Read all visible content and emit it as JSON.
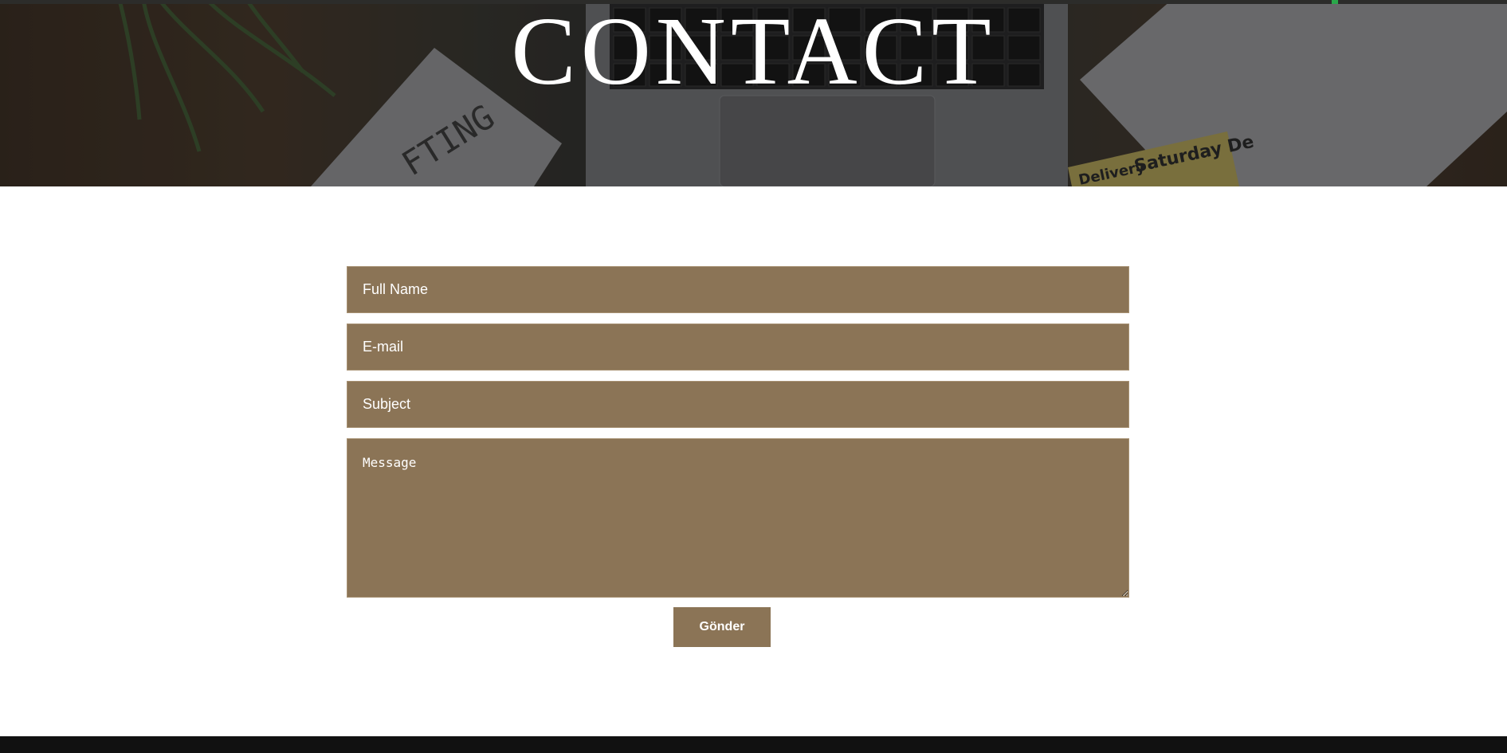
{
  "hero": {
    "title": "CONTACT",
    "image_text": {
      "card": "FTING",
      "label1": "Delivery",
      "label2": "Saturday De"
    }
  },
  "form": {
    "full_name_placeholder": "Full Name",
    "email_placeholder": "E-mail",
    "subject_placeholder": "Subject",
    "message_placeholder": "Message",
    "submit_label": "Gönder"
  },
  "colors": {
    "field_background": "#8b7456",
    "button_background": "#8b7456",
    "footer": "#111111"
  }
}
